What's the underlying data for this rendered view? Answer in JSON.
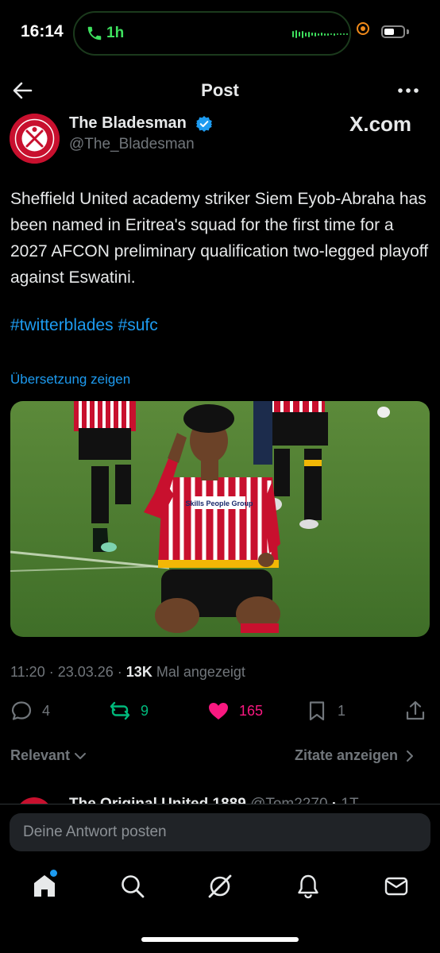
{
  "status_bar": {
    "time": "16:14",
    "call_duration": "1h",
    "battery_level": 0.55
  },
  "header": {
    "title": "Post"
  },
  "author": {
    "name": "The Bladesman",
    "handle": "@The_Bladesman",
    "verified": true,
    "source": "X.com"
  },
  "tweet": {
    "text": "Sheffield United academy striker Siem Eyob-Abraha has been named in Eritrea's squad for the first time for a 2027 AFCON preliminary qualification two-legged playoff against Eswatini.",
    "hashtags": [
      "#twitterblades",
      "#sufc"
    ],
    "translate_label": "Übersetzung zeigen",
    "photo_sponsor_text": "Skills People Group",
    "time": "11:20",
    "date": "23.03.26",
    "views_count": "13K",
    "views_label": "Mal angezeigt"
  },
  "actions": {
    "replies": "4",
    "reposts": "9",
    "likes": "165",
    "bookmarks": "1"
  },
  "colors": {
    "accent": "#1d9bf0",
    "repost": "#00ba7c",
    "like": "#f91880",
    "call_green": "#3ee05e"
  },
  "replies_section": {
    "sort_label": "Relevant",
    "quotes_label": "Zitate anzeigen",
    "peek_name": "The Original United 1889",
    "peek_handle": "@Tom2270",
    "peek_time": "1T"
  },
  "reply_box": {
    "placeholder": "Deine Antwort posten"
  },
  "tabbar": {
    "items": [
      "home-icon",
      "search-icon",
      "grok-icon",
      "notifications-icon",
      "messages-icon"
    ],
    "active": "home-icon"
  }
}
